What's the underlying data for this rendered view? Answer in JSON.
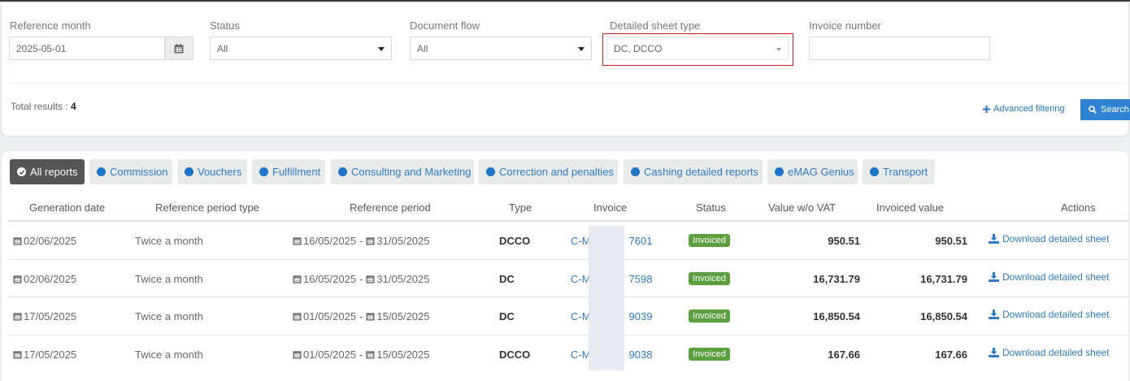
{
  "filters": {
    "reference_month": {
      "label": "Reference month",
      "value": "2025-05-01"
    },
    "status": {
      "label": "Status",
      "value": "All"
    },
    "document_flow": {
      "label": "Document flow",
      "value": "All"
    },
    "detailed_sheet_type": {
      "label": "Detailed sheet type",
      "value": "DC, DCCO"
    },
    "invoice_number": {
      "label": "Invoice number",
      "value": ""
    }
  },
  "summary": {
    "total_label": "Total results :",
    "total_value": "4"
  },
  "actions": {
    "advanced_filtering": "Advanced filtering",
    "search": "Search"
  },
  "tabs": [
    {
      "label": "All reports",
      "active": true
    },
    {
      "label": "Commission"
    },
    {
      "label": "Vouchers"
    },
    {
      "label": "Fulfillment"
    },
    {
      "label": "Consulting and Marketing"
    },
    {
      "label": "Correction and penalties"
    },
    {
      "label": "Cashing detailed reports"
    },
    {
      "label": "eMAG Genius"
    },
    {
      "label": "Transport"
    }
  ],
  "table": {
    "columns": [
      "Generation date",
      "Reference period type",
      "Reference period",
      "Type",
      "Invoice",
      "Status",
      "Value w/o VAT",
      "Invoiced value",
      "Actions"
    ],
    "rows": [
      {
        "generation_date": "02/06/2025",
        "period_type": "Twice a month",
        "period_start": "16/05/2025",
        "period_end": "31/05/2025",
        "type": "DCCO",
        "invoice_prefix": "C-M",
        "invoice_suffix": "7601",
        "status": "Invoiced",
        "value_wo_vat": "950.51",
        "invoiced_value": "950.51",
        "action": "Download detailed sheet"
      },
      {
        "generation_date": "02/06/2025",
        "period_type": "Twice a month",
        "period_start": "16/05/2025",
        "period_end": "31/05/2025",
        "type": "DC",
        "invoice_prefix": "C-M",
        "invoice_suffix": "7598",
        "status": "Invoiced",
        "value_wo_vat": "16,731.79",
        "invoiced_value": "16,731.79",
        "action": "Download detailed sheet"
      },
      {
        "generation_date": "17/05/2025",
        "period_type": "Twice a month",
        "period_start": "01/05/2025",
        "period_end": "15/05/2025",
        "type": "DC",
        "invoice_prefix": "C-M",
        "invoice_suffix": "9039",
        "status": "Invoiced",
        "value_wo_vat": "16,850.54",
        "invoiced_value": "16,850.54",
        "action": "Download detailed sheet"
      },
      {
        "generation_date": "17/05/2025",
        "period_type": "Twice a month",
        "period_start": "01/05/2025",
        "period_end": "15/05/2025",
        "type": "DCCO",
        "invoice_prefix": "C-M",
        "invoice_suffix": "9038",
        "status": "Invoiced",
        "value_wo_vat": "167.66",
        "invoiced_value": "167.66",
        "action": "Download detailed sheet"
      }
    ]
  },
  "colors": {
    "accent": "#2f83d2",
    "link": "#2e7bc4",
    "invoiced": "#5b9f3e",
    "highlight": "#c81e1e"
  }
}
